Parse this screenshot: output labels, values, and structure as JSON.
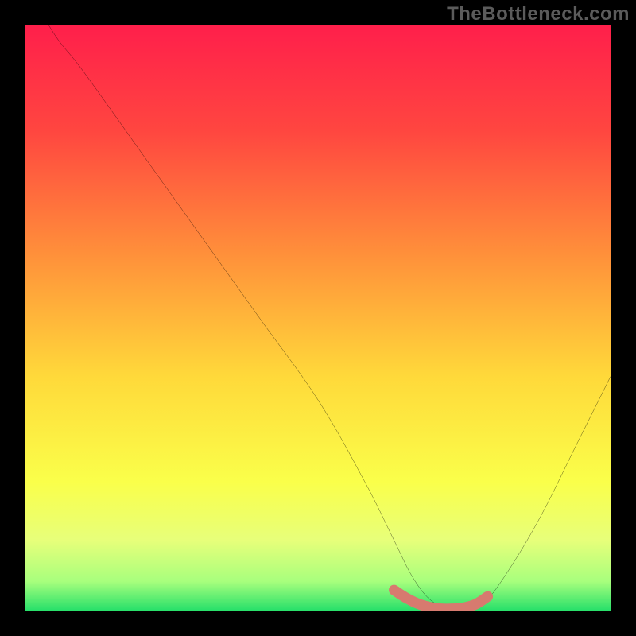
{
  "watermark": "TheBottleneck.com",
  "chart_data": {
    "type": "line",
    "title": "",
    "xlabel": "",
    "ylabel": "",
    "xlim": [
      0,
      100
    ],
    "ylim": [
      0,
      100
    ],
    "grid": false,
    "legend": false,
    "gradient_stops": [
      {
        "offset": 0,
        "color": "#ff1f4b"
      },
      {
        "offset": 18,
        "color": "#ff4640"
      },
      {
        "offset": 40,
        "color": "#ff933a"
      },
      {
        "offset": 60,
        "color": "#ffd93a"
      },
      {
        "offset": 78,
        "color": "#faff4a"
      },
      {
        "offset": 88,
        "color": "#e7ff7a"
      },
      {
        "offset": 95,
        "color": "#a8ff7d"
      },
      {
        "offset": 100,
        "color": "#27e06a"
      }
    ],
    "series": [
      {
        "name": "bottleneck-curve",
        "color": "#000000",
        "width": 1.6,
        "x": [
          4,
          6,
          10,
          20,
          30,
          40,
          50,
          58,
          63,
          66,
          69,
          72,
          75,
          78,
          82,
          88,
          94,
          100
        ],
        "y": [
          100,
          97,
          92,
          78,
          64,
          50,
          36,
          22,
          12,
          6,
          2,
          0.5,
          0.5,
          1,
          6,
          16,
          28,
          40
        ]
      },
      {
        "name": "optimal-zone",
        "color": "#d77a6f",
        "width": 9,
        "x": [
          63,
          65,
          67,
          69,
          71,
          73,
          75,
          77,
          79
        ],
        "y": [
          3.5,
          2.2,
          1.2,
          0.6,
          0.3,
          0.3,
          0.5,
          1.1,
          2.4
        ]
      }
    ]
  }
}
